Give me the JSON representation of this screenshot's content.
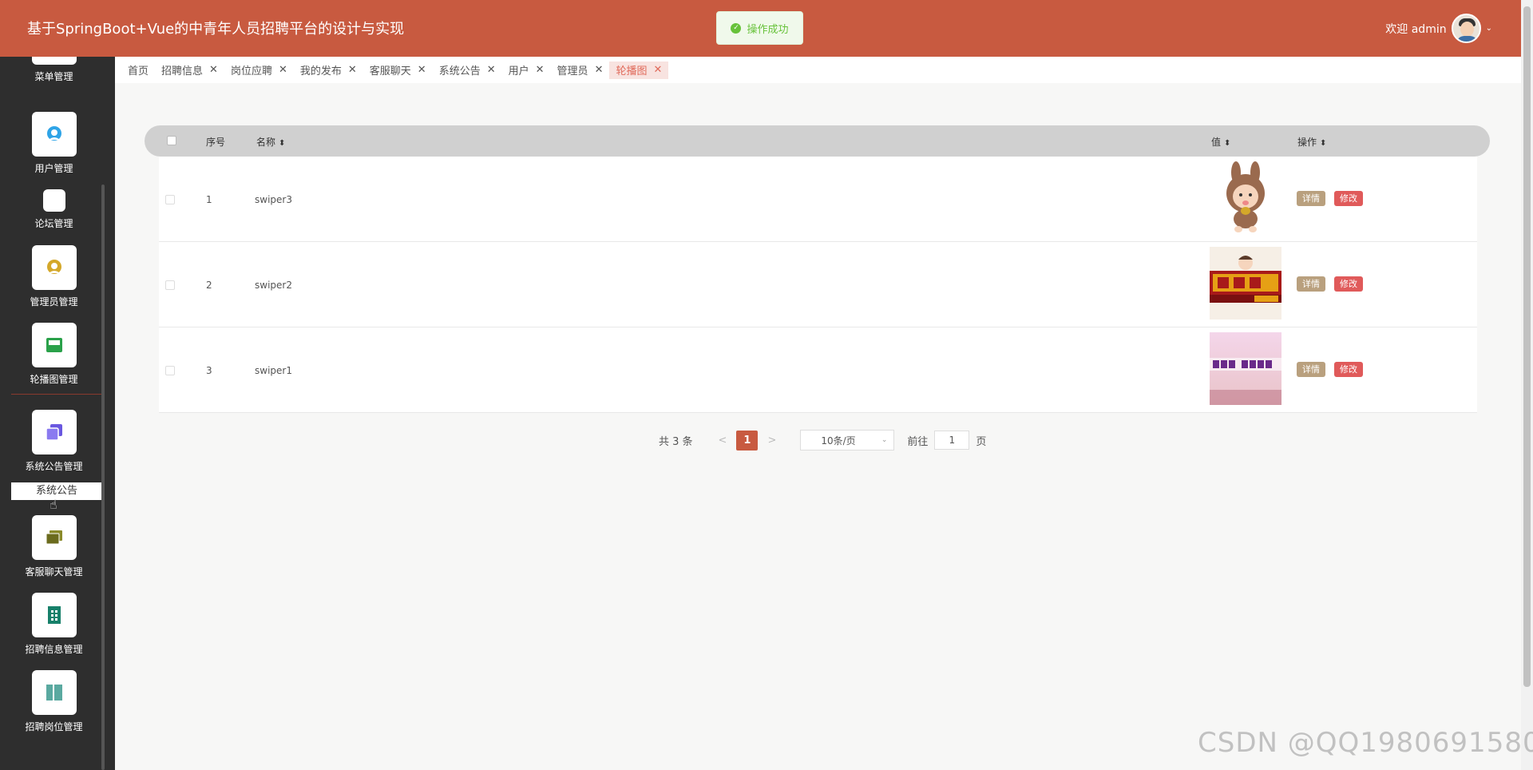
{
  "header": {
    "title": "基于SpringBoot+Vue的中青年人员招聘平台的设计与实现",
    "welcome": "欢迎 admin"
  },
  "toast": {
    "text": "操作成功",
    "type": "success"
  },
  "sidebar": {
    "items": [
      {
        "label": "菜单管理",
        "icon": "menu-icon"
      },
      {
        "label": "用户管理",
        "icon": "user-icon",
        "color": "#2fa4e7"
      },
      {
        "label": "论坛管理",
        "icon": "forum-icon"
      },
      {
        "label": "管理员管理",
        "icon": "admin-icon",
        "color": "#d4a82a"
      },
      {
        "label": "轮播图管理",
        "icon": "carousel-icon",
        "color": "#2aa14a"
      },
      {
        "label": "系统公告管理",
        "icon": "notice-icon",
        "color": "#6a58e0"
      },
      {
        "label": "客服聊天管理",
        "icon": "chat-icon",
        "color": "#8a8a2a"
      },
      {
        "label": "招聘信息管理",
        "icon": "recruit-info-icon",
        "color": "#17806a"
      },
      {
        "label": "招聘岗位管理",
        "icon": "position-icon",
        "color": "#5aa9a0"
      }
    ],
    "submenu": "系统公告"
  },
  "tabs": [
    {
      "label": "首页",
      "closable": false
    },
    {
      "label": "招聘信息",
      "closable": true
    },
    {
      "label": "岗位应聘",
      "closable": true
    },
    {
      "label": "我的发布",
      "closable": true
    },
    {
      "label": "客服聊天",
      "closable": true
    },
    {
      "label": "系统公告",
      "closable": true
    },
    {
      "label": "用户",
      "closable": true
    },
    {
      "label": "管理员",
      "closable": true
    },
    {
      "label": "轮播图",
      "closable": true,
      "active": true
    }
  ],
  "table": {
    "columns": {
      "index": "序号",
      "name": "名称",
      "value": "值",
      "actions": "操作"
    },
    "rows": [
      {
        "index": "1",
        "name": "swiper3",
        "image": "kid-in-bunny-hood"
      },
      {
        "index": "2",
        "name": "swiper2",
        "image": "recruitment-banner-orange"
      },
      {
        "index": "3",
        "name": "swiper1",
        "image": "job-fair-banner-pink"
      }
    ],
    "detail_label": "详情",
    "edit_label": "修改"
  },
  "pagination": {
    "total": "共 3 条",
    "current_page": "1",
    "page_size": "10条/页",
    "goto_label": "前往",
    "goto_value": "1",
    "page_suffix": "页",
    "prev": "<",
    "next": ">"
  },
  "watermark": "CSDN @QQ1980691580",
  "colors": {
    "primary": "#c85a40",
    "detail": "#b9a07e",
    "edit": "#e05a5a",
    "success": "#67c23a"
  }
}
